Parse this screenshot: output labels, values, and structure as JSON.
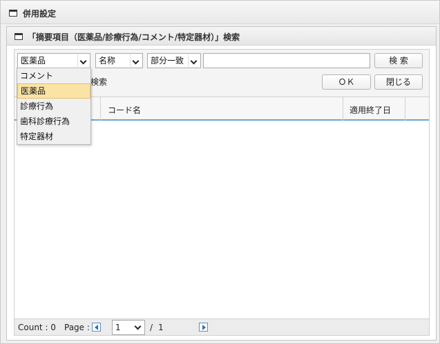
{
  "window": {
    "title": "併用設定"
  },
  "dialog": {
    "title": "「摘要項目（医薬品/診療行為/コメント/特定器材）」検索"
  },
  "search": {
    "category_value": "医薬品",
    "field_value": "名称",
    "match_value": "部分一致",
    "keyword_value": "",
    "search_button": "検 索",
    "ok_button": "ＯＫ",
    "close_button": "閉じる",
    "partial_label": "検索"
  },
  "category_options": [
    "コメント",
    "医薬品",
    "診療行為",
    "歯科診療行為",
    "特定器材"
  ],
  "grid": {
    "columns": [
      "コード名",
      "適用終了日"
    ]
  },
  "footer": {
    "count_label": "Count : 0",
    "page_label": "Page :",
    "page_value": "1",
    "page_separator": "/",
    "total_pages": "1"
  }
}
